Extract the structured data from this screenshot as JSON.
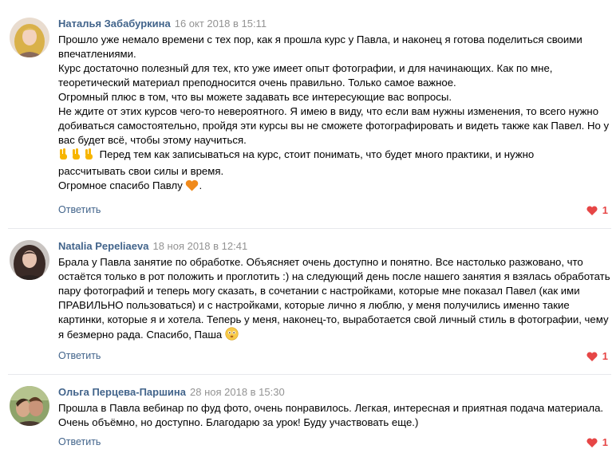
{
  "reply_label": "Ответить",
  "colors": {
    "author": "#42648b",
    "date": "#939393",
    "like": "#e64646",
    "divider": "#e7e8ec"
  },
  "comments": [
    {
      "author": "Наталья Забабуркина",
      "date": "16 окт 2018 в 15:11",
      "lines": [
        "Прошло уже немало времени с тех пор, как я прошла курс у Павла, и наконец я готова поделиться своими",
        "впечатлениями.",
        "Курс достаточно полезный для тех, кто уже имеет опыт фотографии, и для начинающих. Как по мне,",
        "теоретический материал преподносится очень правильно. Только самое важное.",
        "Огромный плюс в том, что вы можете задавать все интересующие вас вопросы.",
        "Не ждите от этих курсов чего-то невероятного. Я имею в виду, что если вам нужны изменения, то всего нужно",
        "добиваться самостоятельно, пройдя эти курсы вы не сможете фотографировать и видеть также как Павел. Но у",
        "вас будет всё, чтобы этому научиться.",
        " Перед тем как записываться на курс, стоит понимать, что будет много практики, и нужно",
        "рассчитывать свои силы и время.",
        "Огромное спасибо Павлу",
        "."
      ],
      "emoji_hands": "hand-victory-icon",
      "emoji_heart": "orange-heart-icon",
      "likes": "1"
    },
    {
      "author": "Natalia Pepeliaeva",
      "date": "18 ноя 2018 в 12:41",
      "lines": [
        "Брала у Павла занятие по обработке. Объясняет очень доступно и понятно. Все настолько разжовано, что",
        "остаётся только в рот положить и проглотить :) на следующий день после нашего занятия я взялась обработать",
        "пару фотографий и теперь могу сказать, в сочетании с настройками, которые мне показал Павел (как ими",
        "ПРАВИЛЬНО пользоваться) и с настройками, которые лично я люблю, у меня получились именно такие",
        "картинки, которые я и хотела. Теперь у меня, наконец-то, выработается свой личный стиль в фотографии, чему",
        "я безмерно рада. Спасибо, Паша"
      ],
      "emoji_smile": "blushing-smile-icon",
      "likes": "1"
    },
    {
      "author": "Ольга Перцева-Паршина",
      "date": "28 ноя 2018 в 15:30",
      "lines": [
        "Прошла в Павла вебинар по фуд фото, очень понравилось. Легкая, интересная и приятная подача материала.",
        "Очень объёмно, но доступно. Благодарю за урок! Буду участвовать еще.)"
      ],
      "likes": "1"
    }
  ]
}
